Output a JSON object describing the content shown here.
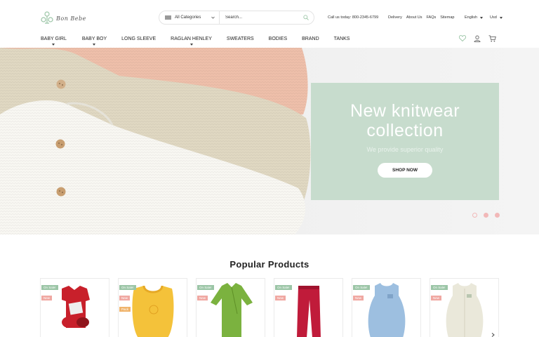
{
  "brand": {
    "name": "Bon Bebe"
  },
  "search": {
    "category": "All Categories",
    "placeholder": "Search..."
  },
  "topbar": {
    "call": "Call us today: 800-2345-6799",
    "links": [
      "Delivery",
      "About Us",
      "FAQs",
      "Sitemap"
    ],
    "language": "English",
    "currency": "Usd"
  },
  "nav": [
    {
      "label": "BABY GIRL",
      "dropdown": true
    },
    {
      "label": "BABY BOY",
      "dropdown": true
    },
    {
      "label": "LONG SLEEVE",
      "dropdown": false
    },
    {
      "label": "RAGLAN HENLEY",
      "dropdown": true
    },
    {
      "label": "SWEATERS",
      "dropdown": false
    },
    {
      "label": "BODIES",
      "dropdown": false
    },
    {
      "label": "BRAND",
      "dropdown": false
    },
    {
      "label": "TANKS",
      "dropdown": false
    }
  ],
  "header_icons": [
    "heart-icon",
    "user-icon",
    "cart-icon"
  ],
  "hero": {
    "title_line1": "New knitwear",
    "title_line2": "collection",
    "subtitle": "We provide superior quality",
    "cta": "SHOP NOW",
    "slides": 3,
    "active_slide": 1
  },
  "products_section": {
    "title": "Popular Products",
    "items": [
      {
        "badges": [
          "On Sale!",
          "New"
        ],
        "kind": "red-bodysuit-set"
      },
      {
        "badges": [
          "On Sale!",
          "New",
          "Pack"
        ],
        "kind": "yellow-bib"
      },
      {
        "badges": [
          "On Sale!",
          "New"
        ],
        "kind": "green-romper"
      },
      {
        "badges": [
          "On Sale!",
          "New"
        ],
        "kind": "red-pants"
      },
      {
        "badges": [
          "On Sale!",
          "New"
        ],
        "kind": "blue-sleep-sack"
      },
      {
        "badges": [
          "On Sale!",
          "New"
        ],
        "kind": "white-sleep-sack"
      }
    ]
  },
  "colors": {
    "accent": "#9bc5a6",
    "promo_bg": "#c7dccd",
    "sale_badge": "#9bc5a6",
    "new_badge": "#f0a8a2",
    "pack_badge": "#f0b46c",
    "dot": "#f2b8b8"
  }
}
